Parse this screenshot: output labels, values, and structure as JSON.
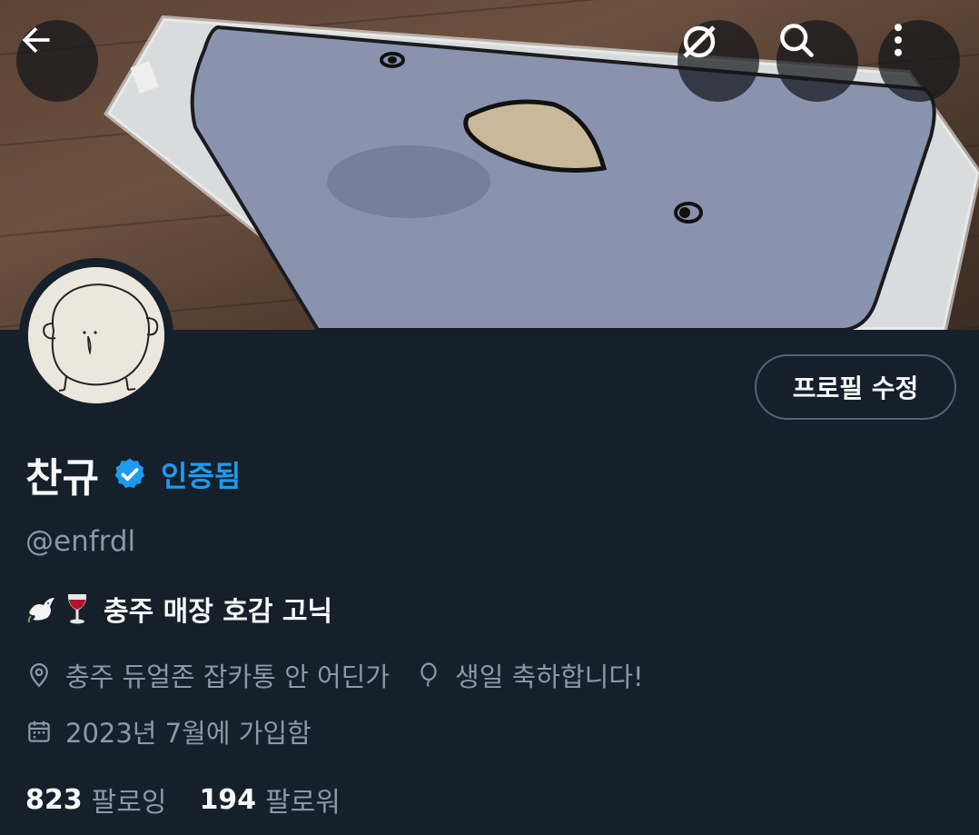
{
  "header": {
    "back_icon": "arrow-left-icon",
    "grok_icon": "grok-slash-icon",
    "search_icon": "search-icon",
    "more_icon": "more-vertical-icon"
  },
  "profile": {
    "display_name": "찬규",
    "verified_label": "인증됨",
    "handle": "@enfrdl",
    "bio_text": "충주 매장 호감 고닉",
    "bio_emojis": [
      "dove",
      "wine-glass"
    ],
    "location": "충주 듀얼존 잡카통 안 어딘가",
    "birthday": "생일 축하합니다!",
    "joined": "2023년 7월에 가입함",
    "edit_button": "프로필 수정"
  },
  "stats": {
    "following_count": "823",
    "following_label": "팔로잉",
    "followers_count": "194",
    "followers_label": "팔로워"
  },
  "colors": {
    "background": "#15202b",
    "accent": "#1d9bf0",
    "secondary_text": "#8b98a5",
    "border": "#536471"
  }
}
